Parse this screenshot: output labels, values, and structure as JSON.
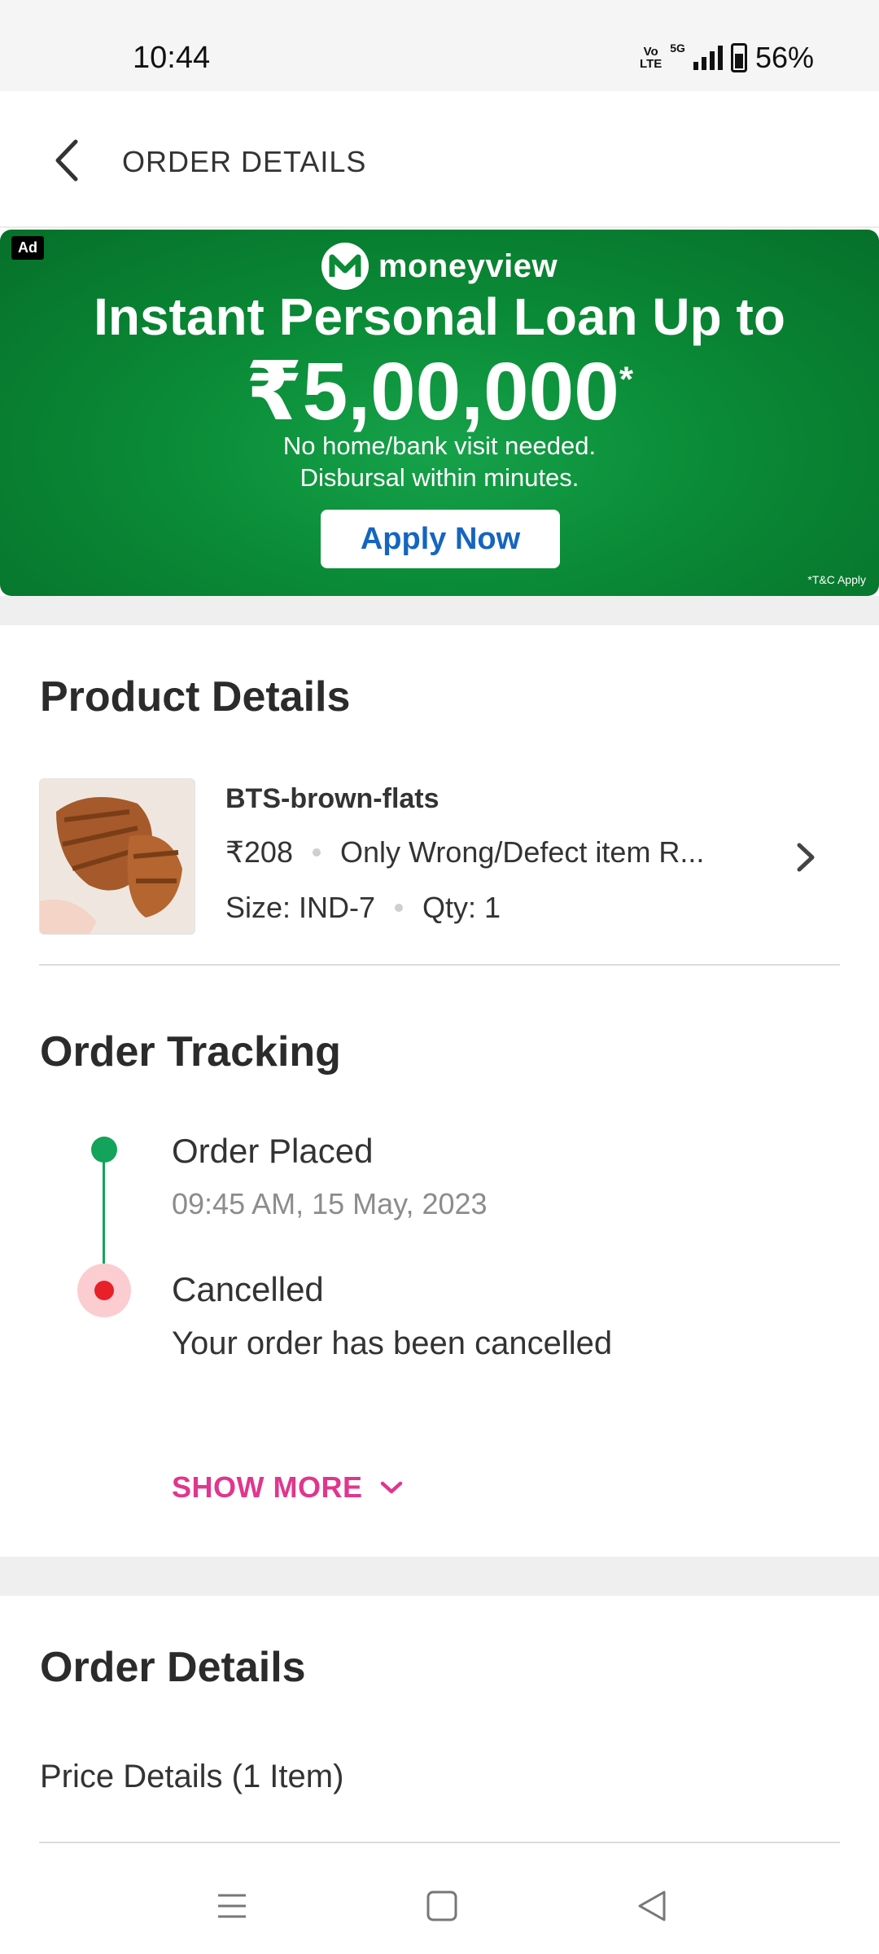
{
  "status_bar": {
    "time": "10:44",
    "volte_top": "Vo",
    "volte_bottom": "LTE",
    "network": "5G",
    "battery": "56%"
  },
  "header": {
    "title": "ORDER DETAILS",
    "back_icon": "chevron-left-icon"
  },
  "ad": {
    "tag": "Ad",
    "brand": "moneyview",
    "headline": "Instant Personal Loan Up to",
    "amount": "₹5,00,000",
    "amount_mark": "*",
    "subtext_1": "No home/bank visit needed.",
    "subtext_2": "Disbursal within minutes.",
    "cta": "Apply Now",
    "terms": "*T&C Apply",
    "colors": {
      "background": "#0a8a36",
      "cta_text": "#1565c0"
    }
  },
  "product_section": {
    "title": "Product Details",
    "product": {
      "name": "BTS-brown-flats",
      "price": "₹208",
      "return_policy": "Only Wrong/Defect item R...",
      "size": "Size: IND-7",
      "qty": "Qty: 1"
    }
  },
  "tracking_section": {
    "title": "Order Tracking",
    "steps": [
      {
        "title": "Order Placed",
        "detail": "09:45 AM, 15 May, 2023",
        "status_color": "#14a35a"
      },
      {
        "title": "Cancelled",
        "detail": "Your order has been cancelled",
        "status_color": "#e8202a"
      }
    ],
    "show_more": "SHOW MORE"
  },
  "order_section": {
    "title": "Order Details",
    "price_details": "Price Details (1 Item)"
  },
  "accent_color": "#e0368e"
}
